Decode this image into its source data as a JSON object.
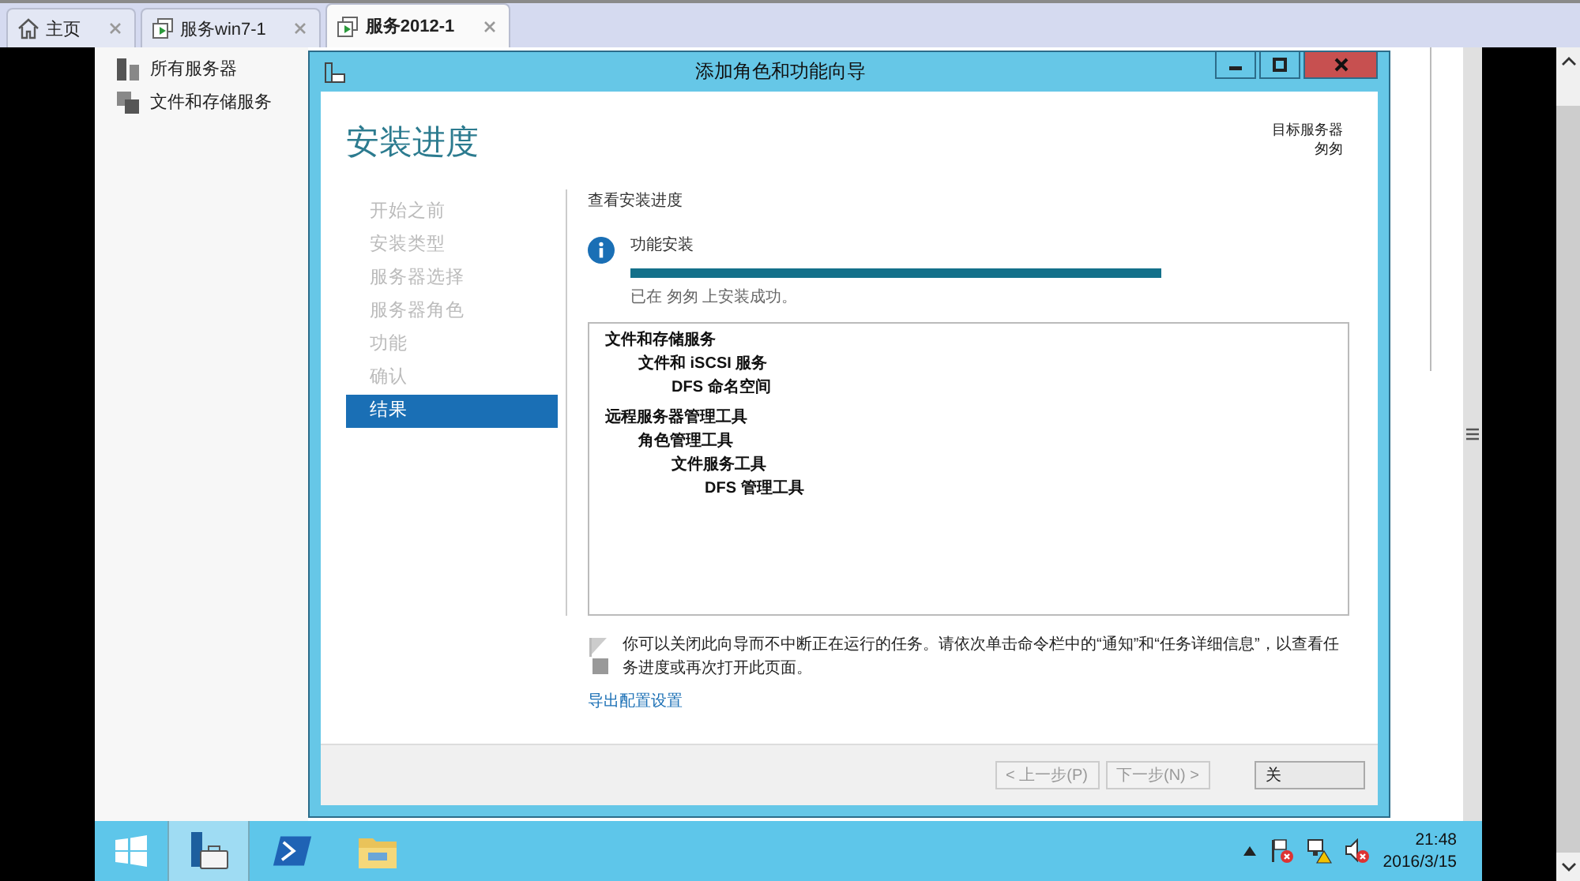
{
  "browser_tabs": [
    {
      "label": "主页",
      "kind": "home",
      "selected": false
    },
    {
      "label": "服务win7-1",
      "kind": "vm",
      "selected": false
    },
    {
      "label": "服务2012-1",
      "kind": "vm",
      "selected": true
    }
  ],
  "server_manager": {
    "nav": [
      {
        "label": "所有服务器",
        "kind": "all"
      },
      {
        "label": "文件和存储服务",
        "kind": "storage"
      }
    ]
  },
  "wizard": {
    "title": "添加角色和功能向导",
    "heading": "安装进度",
    "target_label": "目标服务器",
    "target_name": "匆匆",
    "steps": [
      {
        "label": "开始之前",
        "selected": false
      },
      {
        "label": "安装类型",
        "selected": false
      },
      {
        "label": "服务器选择",
        "selected": false
      },
      {
        "label": "服务器角色",
        "selected": false
      },
      {
        "label": "功能",
        "selected": false
      },
      {
        "label": "确认",
        "selected": false
      },
      {
        "label": "结果",
        "selected": true
      }
    ],
    "section_title": "查看安装进度",
    "task": {
      "label": "功能安装",
      "level": 1,
      "status": "已在 匆匆 上安装成功。"
    },
    "results": [
      {
        "label": "文件和存储服务",
        "children": [
          {
            "label": "文件和 iSCSI 服务",
            "children": [
              {
                "label": "DFS 命名空间"
              }
            ]
          }
        ]
      },
      {
        "label": "远程服务器管理工具",
        "children": [
          {
            "label": "角色管理工具",
            "children": [
              {
                "label": "文件服务工具",
                "children": [
                  {
                    "label": "DFS 管理工具"
                  }
                ]
              }
            ]
          }
        ]
      }
    ],
    "note": "你可以关闭此向导而不中断正在运行的任务。请依次单击命令栏中的“通知”和“任务详细信息”，以查看任务进度或再次打开此页面。",
    "export_link": "导出配置设置",
    "buttons": [
      {
        "label": "< 上一步(P)",
        "disabled": true
      },
      {
        "label": "下一步(N) >",
        "disabled": true
      },
      {
        "label": "关",
        "disabled": false
      }
    ]
  },
  "taskbar": {
    "apps": [
      {
        "kind": "server-manager",
        "selected": true
      },
      {
        "kind": "powershell",
        "selected": false
      },
      {
        "kind": "explorer",
        "selected": false
      }
    ],
    "time": "21:48",
    "date": "2016/3/15"
  }
}
